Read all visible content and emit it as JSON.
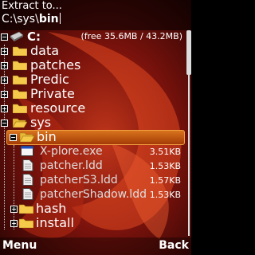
{
  "header": {
    "title": "Extract to...",
    "path_prefix": "C:\\sys\\",
    "path_current": "bin"
  },
  "drive": {
    "label": "C:",
    "info": "(free 35.6MB / 43.2MB)"
  },
  "folders_top": [
    "data",
    "patches",
    "Predic",
    "Private",
    "resource",
    "sys"
  ],
  "selected_folder": "bin",
  "files": [
    {
      "name": "X-plore.exe",
      "size": "3.51KB",
      "icon": "exe-icon"
    },
    {
      "name": "patcher.ldd",
      "size": "1.53KB",
      "icon": "document-icon"
    },
    {
      "name": "patcherS3.ldd",
      "size": "1.57KB",
      "icon": "document-icon"
    },
    {
      "name": "patcherShadow.ldd",
      "size": "1.53KB",
      "icon": "document-icon"
    }
  ],
  "folders_bottom": [
    "hash",
    "install"
  ],
  "softkeys": {
    "left": "Menu",
    "right": "Back"
  },
  "colors": {
    "selection": "#d8741d",
    "folder": "#f5c94a",
    "background": "#5a0a08"
  }
}
